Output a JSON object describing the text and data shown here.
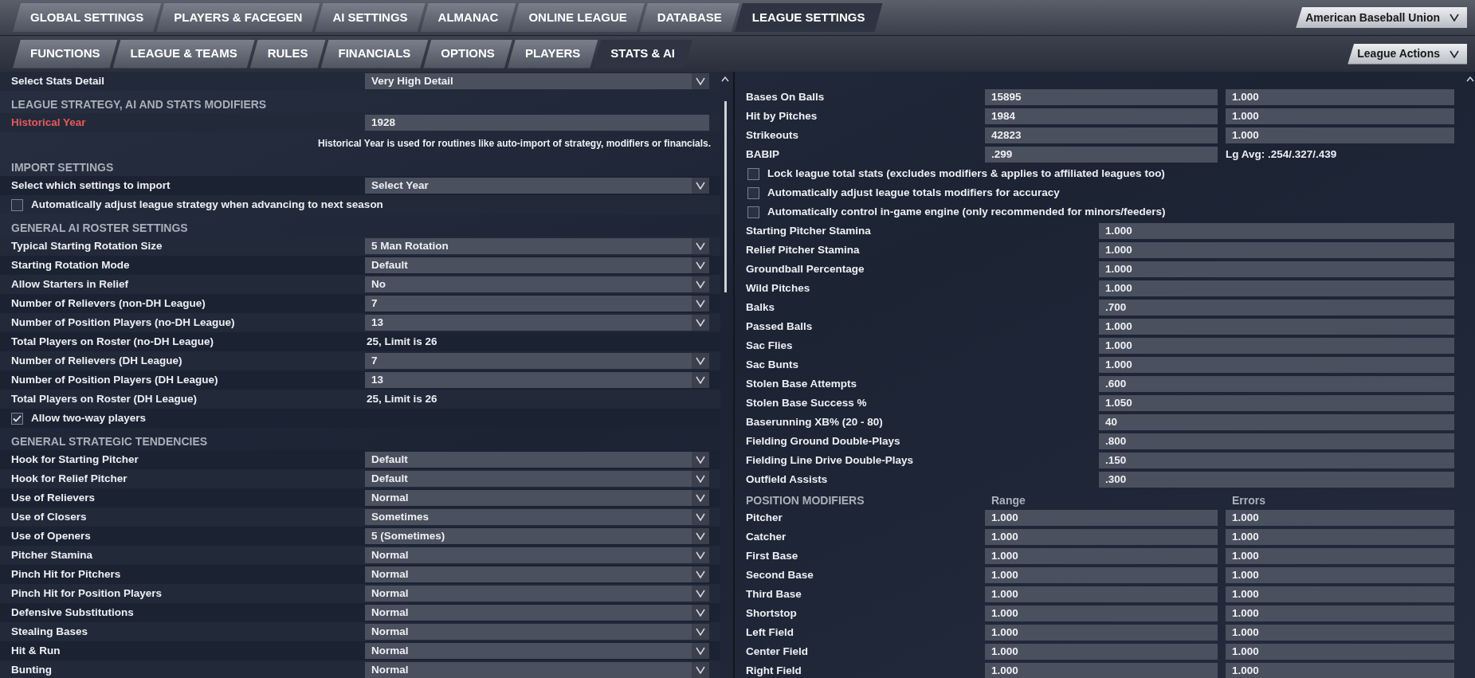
{
  "top_tabs": [
    {
      "label": "GLOBAL SETTINGS",
      "selected": false
    },
    {
      "label": "PLAYERS & FACEGEN",
      "selected": false
    },
    {
      "label": "AI SETTINGS",
      "selected": false
    },
    {
      "label": "ALMANAC",
      "selected": false
    },
    {
      "label": "ONLINE LEAGUE",
      "selected": false
    },
    {
      "label": "DATABASE",
      "selected": false
    },
    {
      "label": "LEAGUE SETTINGS",
      "selected": true
    }
  ],
  "league_dropdown": {
    "value": "American Baseball Union"
  },
  "sub_tabs": [
    {
      "label": "FUNCTIONS",
      "selected": false
    },
    {
      "label": "LEAGUE & TEAMS",
      "selected": false
    },
    {
      "label": "RULES",
      "selected": false
    },
    {
      "label": "FINANCIALS",
      "selected": false
    },
    {
      "label": "OPTIONS",
      "selected": false
    },
    {
      "label": "PLAYERS",
      "selected": false
    },
    {
      "label": "STATS & AI",
      "selected": true
    }
  ],
  "actions_dropdown": {
    "value": "League Actions"
  },
  "left_panel": {
    "items": [
      {
        "kind": "dropdown",
        "label": "Select Stats Detail",
        "value": "Very High Detail"
      },
      {
        "kind": "header",
        "label": "LEAGUE STRATEGY, AI AND STATS MODIFIERS"
      },
      {
        "kind": "input",
        "label": "Historical Year",
        "value": "1928",
        "highlighted": true
      },
      {
        "kind": "note",
        "label": "Historical Year is used for routines like auto-import of strategy, modifiers or financials."
      },
      {
        "kind": "header",
        "label": "IMPORT SETTINGS"
      },
      {
        "kind": "dropdown",
        "label": "Select which settings to import",
        "value": "Select Year"
      },
      {
        "kind": "checkbox",
        "label": "Automatically adjust league strategy when advancing to next season",
        "checked": false
      },
      {
        "kind": "header",
        "label": "GENERAL AI ROSTER SETTINGS"
      },
      {
        "kind": "dropdown",
        "label": "Typical Starting Rotation Size",
        "value": "5 Man Rotation"
      },
      {
        "kind": "dropdown",
        "label": "Starting Rotation Mode",
        "value": "Default"
      },
      {
        "kind": "dropdown",
        "label": "Allow Starters in Relief",
        "value": "No"
      },
      {
        "kind": "dropdown",
        "label": "Number of Relievers (non-DH League)",
        "value": "7"
      },
      {
        "kind": "dropdown",
        "label": "Number of Position Players (no-DH League)",
        "value": "13"
      },
      {
        "kind": "text",
        "label": "Total Players on Roster (no-DH League)",
        "value": "25, Limit is 26"
      },
      {
        "kind": "dropdown",
        "label": "Number of Relievers (DH League)",
        "value": "7"
      },
      {
        "kind": "dropdown",
        "label": "Number of Position Players (DH League)",
        "value": "13"
      },
      {
        "kind": "text",
        "label": "Total Players on Roster (DH League)",
        "value": "25, Limit is 26"
      },
      {
        "kind": "checkbox",
        "label": "Allow two-way players",
        "checked": true
      },
      {
        "kind": "header",
        "label": "GENERAL STRATEGIC TENDENCIES"
      },
      {
        "kind": "dropdown",
        "label": "Hook for Starting Pitcher",
        "value": "Default"
      },
      {
        "kind": "dropdown",
        "label": "Hook for Relief Pitcher",
        "value": "Default"
      },
      {
        "kind": "dropdown",
        "label": "Use of Relievers",
        "value": "Normal"
      },
      {
        "kind": "dropdown",
        "label": "Use of Closers",
        "value": "Sometimes"
      },
      {
        "kind": "dropdown",
        "label": "Use of Openers",
        "value": "5 (Sometimes)"
      },
      {
        "kind": "dropdown",
        "label": "Pitcher Stamina",
        "value": "Normal"
      },
      {
        "kind": "dropdown",
        "label": "Pinch Hit for Pitchers",
        "value": "Normal"
      },
      {
        "kind": "dropdown",
        "label": "Pinch Hit for Position Players",
        "value": "Normal"
      },
      {
        "kind": "dropdown",
        "label": "Defensive Substitutions",
        "value": "Normal"
      },
      {
        "kind": "dropdown",
        "label": "Stealing Bases",
        "value": "Normal"
      },
      {
        "kind": "dropdown",
        "label": "Hit & Run",
        "value": "Normal"
      },
      {
        "kind": "dropdown",
        "label": "Bunting",
        "value": "Normal"
      }
    ]
  },
  "right_panel": {
    "items": [
      {
        "kind": "stat",
        "label": "Bases On Balls",
        "total": "15895",
        "modifier": "1.000"
      },
      {
        "kind": "stat",
        "label": "Hit by Pitches",
        "total": "1984",
        "modifier": "1.000"
      },
      {
        "kind": "stat",
        "label": "Strikeouts",
        "total": "42823",
        "modifier": "1.000"
      },
      {
        "kind": "stat_note",
        "label": "BABIP",
        "total": ".299",
        "note": "Lg Avg: .254/.327/.439"
      },
      {
        "kind": "checkbox",
        "label": "Lock league total stats (excludes modifiers & applies to affiliated leagues too)",
        "checked": false
      },
      {
        "kind": "checkbox",
        "label": "Automatically adjust league totals modifiers for accuracy",
        "checked": false
      },
      {
        "kind": "checkbox",
        "label": "Automatically control in-game engine (only recommended for minors/feeders)",
        "checked": false
      },
      {
        "kind": "modifier",
        "label": "Starting Pitcher Stamina",
        "value": "1.000"
      },
      {
        "kind": "modifier",
        "label": "Relief Pitcher Stamina",
        "value": "1.000"
      },
      {
        "kind": "modifier",
        "label": "Groundball Percentage",
        "value": "1.000"
      },
      {
        "kind": "modifier",
        "label": "Wild Pitches",
        "value": "1.000"
      },
      {
        "kind": "modifier",
        "label": "Balks",
        "value": ".700"
      },
      {
        "kind": "modifier",
        "label": "Passed Balls",
        "value": "1.000"
      },
      {
        "kind": "modifier",
        "label": "Sac Flies",
        "value": "1.000"
      },
      {
        "kind": "modifier",
        "label": "Sac Bunts",
        "value": "1.000"
      },
      {
        "kind": "modifier",
        "label": "Stolen Base Attempts",
        "value": ".600"
      },
      {
        "kind": "modifier",
        "label": "Stolen Base Success %",
        "value": "1.050"
      },
      {
        "kind": "modifier",
        "label": "Baserunning XB% (20 - 80)",
        "value": "40"
      },
      {
        "kind": "modifier",
        "label": "Fielding Ground Double-Plays",
        "value": ".800"
      },
      {
        "kind": "modifier",
        "label": "Fielding Line Drive Double-Plays",
        "value": ".150"
      },
      {
        "kind": "modifier",
        "label": "Outfield Assists",
        "value": ".300"
      },
      {
        "kind": "section",
        "label": "POSITION MODIFIERS",
        "column_1": "Range",
        "column_2": "Errors"
      },
      {
        "kind": "position",
        "label": "Pitcher",
        "range": "1.000",
        "errors": "1.000"
      },
      {
        "kind": "position",
        "label": "Catcher",
        "range": "1.000",
        "errors": "1.000"
      },
      {
        "kind": "position",
        "label": "First Base",
        "range": "1.000",
        "errors": "1.000"
      },
      {
        "kind": "position",
        "label": "Second Base",
        "range": "1.000",
        "errors": "1.000"
      },
      {
        "kind": "position",
        "label": "Third Base",
        "range": "1.000",
        "errors": "1.000"
      },
      {
        "kind": "position",
        "label": "Shortstop",
        "range": "1.000",
        "errors": "1.000"
      },
      {
        "kind": "position",
        "label": "Left Field",
        "range": "1.000",
        "errors": "1.000"
      },
      {
        "kind": "position",
        "label": "Center Field",
        "range": "1.000",
        "errors": "1.000"
      },
      {
        "kind": "position",
        "label": "Right Field",
        "range": "1.000",
        "errors": "1.000"
      }
    ]
  }
}
